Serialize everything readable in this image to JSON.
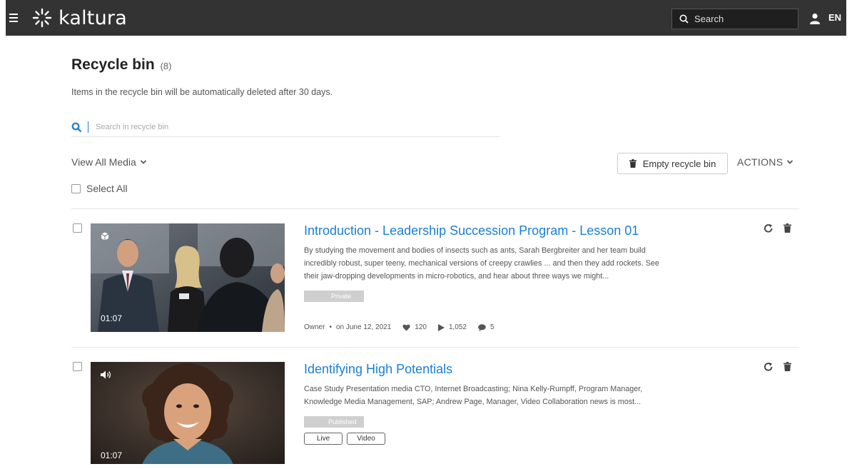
{
  "header": {
    "brand": "kaltura",
    "search_placeholder": "Search",
    "language": "EN"
  },
  "page": {
    "title": "Recycle bin",
    "count": "(8)",
    "subtitle": "Items in the recycle bin will be automatically deleted after 30 days.",
    "search_placeholder": "Search in recycle bin",
    "view_all": "View All Media",
    "empty_button": "Empty recycle bin",
    "actions": "ACTIONS",
    "select_all": "Select All"
  },
  "entries": [
    {
      "title": "Introduction - Leadership Succession Program - Lesson 01",
      "description": "By studying the movement and bodies of insects such as ants, Sarah Bergbreiter and her team build incredibly robust, super teeny, mechanical versions of creepy crawlies ... and then they add rockets. See their jaw-dropping developments in micro-robotics, and hear about three ways we might...",
      "duration": "01:07",
      "status": "Private",
      "owner": "Owner",
      "date": "on June 12, 2021",
      "likes": "120",
      "plays": "1,052",
      "comments": "5",
      "type_icon": "cube-icon"
    },
    {
      "title": "Identifying High Potentials",
      "description": "Case Study Presentation media CTO, Internet Broadcasting; Nina Kelly-Rumpff, Program Manager, Knowledge Media Management, SAP; Andrew Page, Manager, Video Collaboration news is most...",
      "duration": "01:07",
      "status": "Published",
      "tags": [
        "Live",
        "Video"
      ],
      "type_icon": "speaker-icon"
    }
  ],
  "colors": {
    "topbar": "#333333",
    "link": "#1a7fd4",
    "badge": "#cfcfcf"
  }
}
